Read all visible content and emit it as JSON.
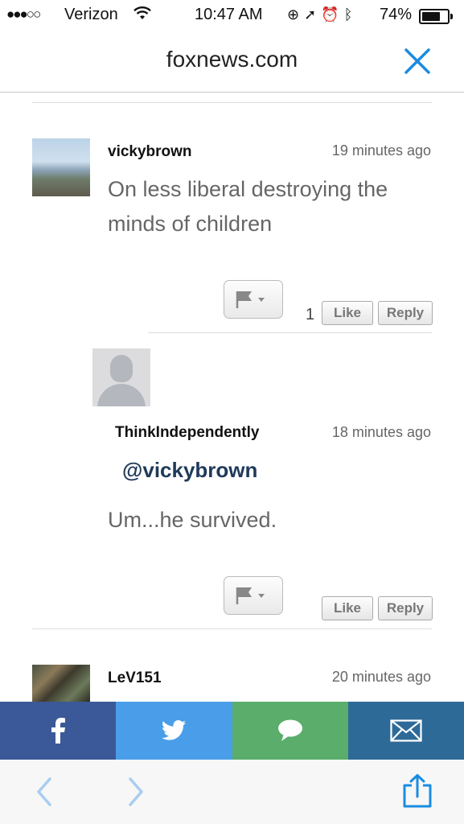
{
  "status_bar": {
    "signal": "●●●○○",
    "carrier": "Verizon",
    "time": "10:47 AM",
    "battery_percent": "74%",
    "battery_level": 0.74
  },
  "nav": {
    "title": "foxnews.com",
    "close_icon": "close-icon",
    "accent_color": "#1a8ce0"
  },
  "comments": [
    {
      "username": "vickybrown",
      "time": "19 minutes ago",
      "body_line1": "On less liberal destroying the",
      "body_line2": "minds of children",
      "like_count": "1",
      "like_label": "Like",
      "reply_label": "Reply"
    },
    {
      "username": "ThinkIndependently",
      "time": "18 minutes ago",
      "mention": "@vickybrown",
      "body": "Um...he survived.",
      "like_label": "Like",
      "reply_label": "Reply"
    },
    {
      "username": "LeV151",
      "time": "20 minutes ago"
    }
  ],
  "share_bar": {
    "items": [
      {
        "icon": "facebook-icon",
        "color": "#3b5998"
      },
      {
        "icon": "twitter-icon",
        "color": "#4a9de8"
      },
      {
        "icon": "message-icon",
        "color": "#5aad6b"
      },
      {
        "icon": "email-icon",
        "color": "#2e6a98"
      }
    ]
  },
  "toolbar": {
    "back_icon": "back-chevron-icon",
    "forward_icon": "forward-chevron-icon",
    "share_icon": "share-icon"
  }
}
